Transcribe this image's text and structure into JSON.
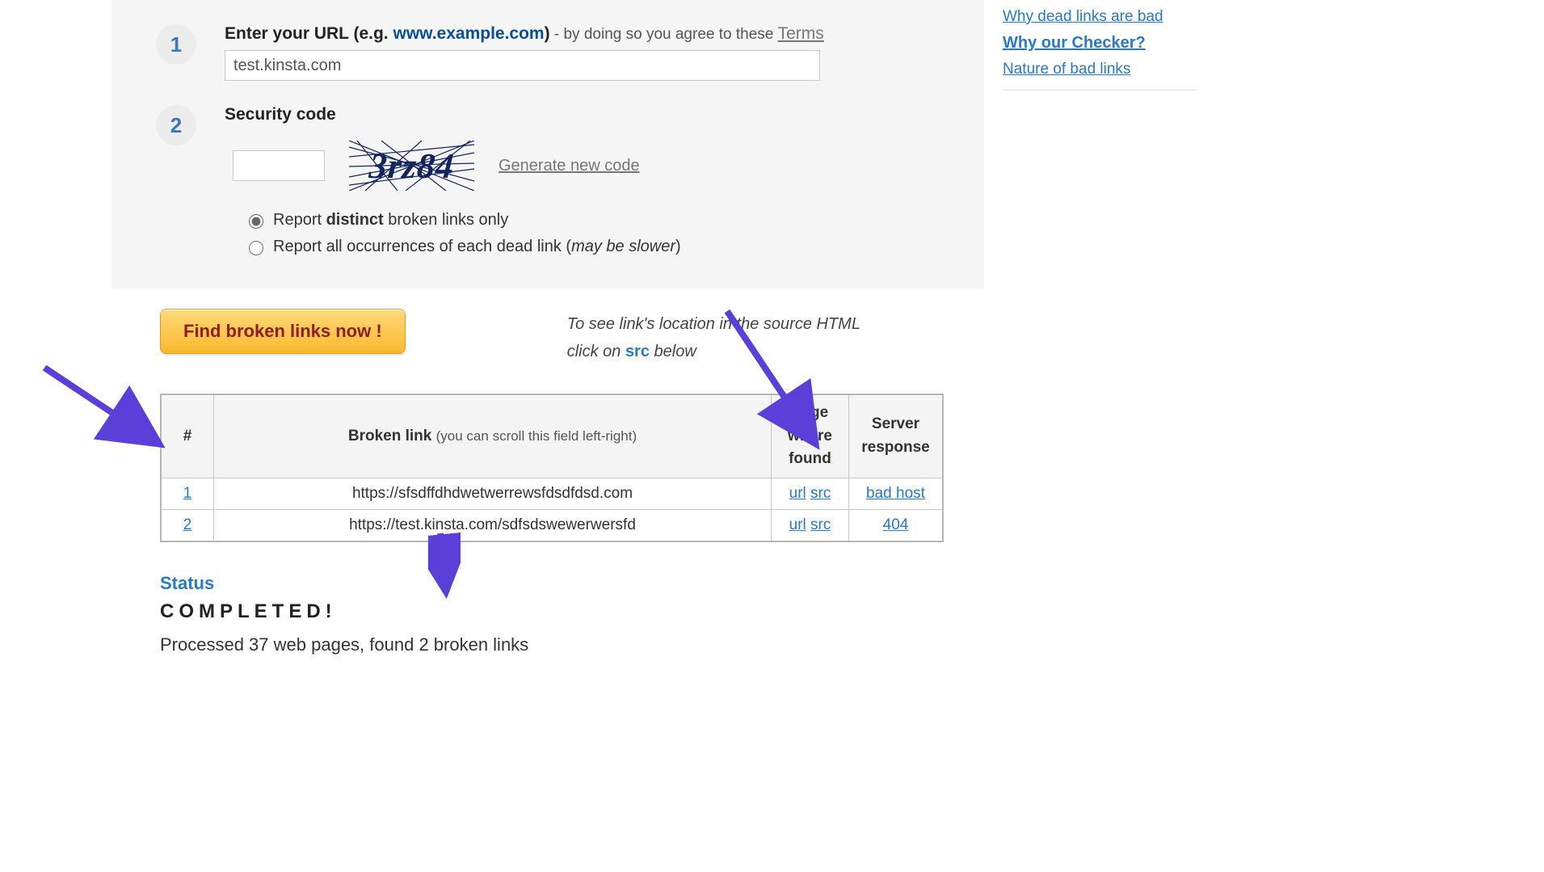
{
  "step1": {
    "number": "1",
    "label_prefix": "Enter your URL (e.g. ",
    "example_url": "www.example.com",
    "label_close": ")",
    "tail": " - by doing so you agree to these ",
    "terms": "Terms",
    "url_value": "test.kinsta.com"
  },
  "step2": {
    "number": "2",
    "label": "Security code",
    "captcha_text": "3rz84",
    "gen_code": "Generate new code",
    "sec_value": ""
  },
  "options": {
    "distinct_pre": "Report ",
    "distinct_bold": "distinct",
    "distinct_post": " broken links only",
    "all_pre": "Report all occurrences of each dead link (",
    "all_em": "may be slower",
    "all_post": ")"
  },
  "action": {
    "find_button": "Find broken links now !",
    "hint_line1_pre": "To see link's location in the source HTML",
    "hint_line2_pre": "click on ",
    "hint_src": "src",
    "hint_line2_post": " below"
  },
  "table": {
    "col_num": "#",
    "col_link": "Broken link",
    "col_link_sub": "(you can scroll this field left-right)",
    "col_pwf_l1": "Page",
    "col_pwf_l2": "where",
    "col_pwf_l3": "found",
    "col_resp_l1": "Server",
    "col_resp_l2": "response",
    "url_label": "url",
    "src_label": "src",
    "rows": [
      {
        "n": "1",
        "link": "https://sfsdffdhdwetwerrewsfdsdfdsd.com",
        "resp": "bad host"
      },
      {
        "n": "2",
        "link": "https://test.kinsta.com/sdfsdswewerwersfd",
        "resp": "404"
      }
    ]
  },
  "status": {
    "heading": "Status",
    "completed": "COMPLETED!",
    "summary": "Processed 37 web pages, found 2 broken links"
  },
  "sidebar": {
    "links": [
      "Why dead links are bad",
      "Why our Checker?",
      "Nature of bad links"
    ]
  }
}
